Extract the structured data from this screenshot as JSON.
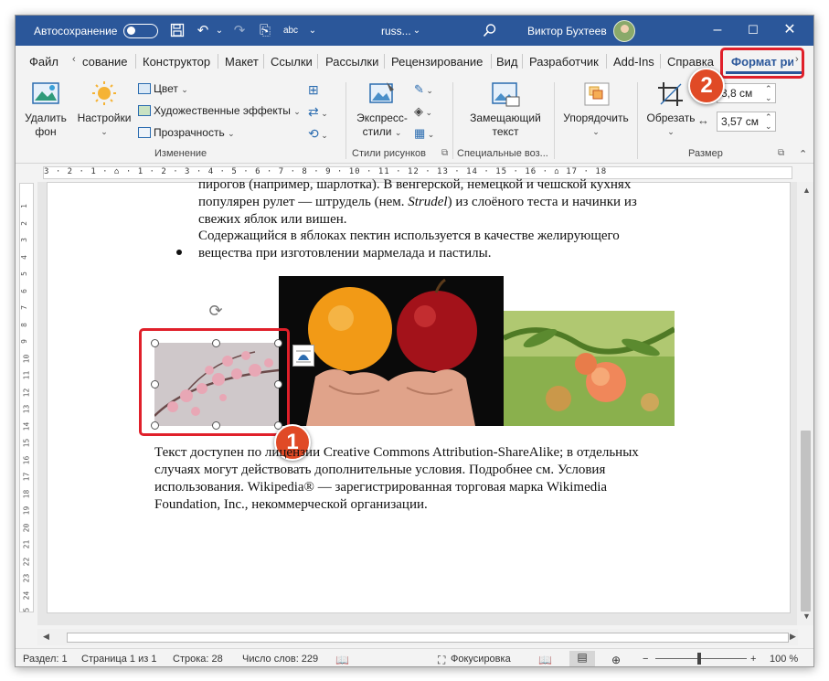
{
  "titlebar": {
    "autosave_label": "Автосохранение",
    "doc_name": "russ...",
    "user_name": "Виктор Бухтеев"
  },
  "tabs": {
    "file": "Файл",
    "home_partial": "сование",
    "design": "Конструктор",
    "layout": "Макет",
    "references": "Ссылки",
    "mailings": "Рассылки",
    "review": "Рецензирование",
    "view": "Вид",
    "developer": "Разработчик",
    "addins": "Add-Ins",
    "help": "Справка",
    "picture_format": "Формат ри"
  },
  "ribbon": {
    "remove_bg": [
      "Удалить",
      "фон"
    ],
    "corrections": "Настройки",
    "color": "Цвет",
    "artistic": "Художественные эффекты",
    "transparency": "Прозрачность",
    "group_adjust": "Изменение",
    "quick_styles": [
      "Экспресс-",
      "стили"
    ],
    "group_styles": "Стили рисунков",
    "alt_text": [
      "Замещающий",
      "текст"
    ],
    "group_access": "Специальные воз...",
    "arrange": "Упорядочить",
    "crop": "Обрезать",
    "height": "3,8 см",
    "width": "3,57 см",
    "group_size": "Размер"
  },
  "ruler": {
    "horizontal": "3 · 2 · 1 · ⌂ · 1 · 2 · 3 · 4 · 5 · 6 · 7 · 8 · 9 · 10 · 11 · 12 · 13 · 14 · 15 · 16 · ⌂ 17 · 18",
    "vertical": [
      "1",
      "2",
      "3",
      "4",
      "5",
      "6",
      "7",
      "8",
      "9",
      "10",
      "11",
      "12",
      "13",
      "14",
      "15",
      "16",
      "17",
      "18",
      "19",
      "20",
      "21",
      "22",
      "23",
      "24",
      "25"
    ]
  },
  "document": {
    "line1": "пирогов (например, шарлотка). В венгерской, немецкой и чешской кухнях",
    "line2_a": "популярен рулет — штрудель (нем. ",
    "line2_em": "Strudel",
    "line2_b": ") из слоёного теста и начинки из",
    "line3": "свежих яблок или вишен.",
    "bullet_line1": "Содержащийся в яблоках пектин используется в качестве желирующего",
    "bullet_line2": "вещества при изготовлении мармелада и пастилы.",
    "license_line1": "Текст доступен по лицензии Creative Commons Attribution-ShareAlike; в отдельных",
    "license_line2": "случаях могут действовать дополнительные условия. Подробнее см. Условия",
    "license_line3": "использования. Wikipedia® — зарегистрированная торговая марка Wikimedia",
    "license_line4": "Foundation, Inc., некоммерческой организации."
  },
  "callouts": {
    "one": "1",
    "two": "2"
  },
  "statusbar": {
    "section": "Раздел: 1",
    "page": "Страница 1 из 1",
    "line": "Строка: 28",
    "words": "Число слов: 229",
    "focus": "Фокусировка",
    "zoom": "100 %"
  },
  "colors": {
    "title_bar": "#2b579a",
    "callout": "#e0202a",
    "badge": "#e04a26"
  }
}
